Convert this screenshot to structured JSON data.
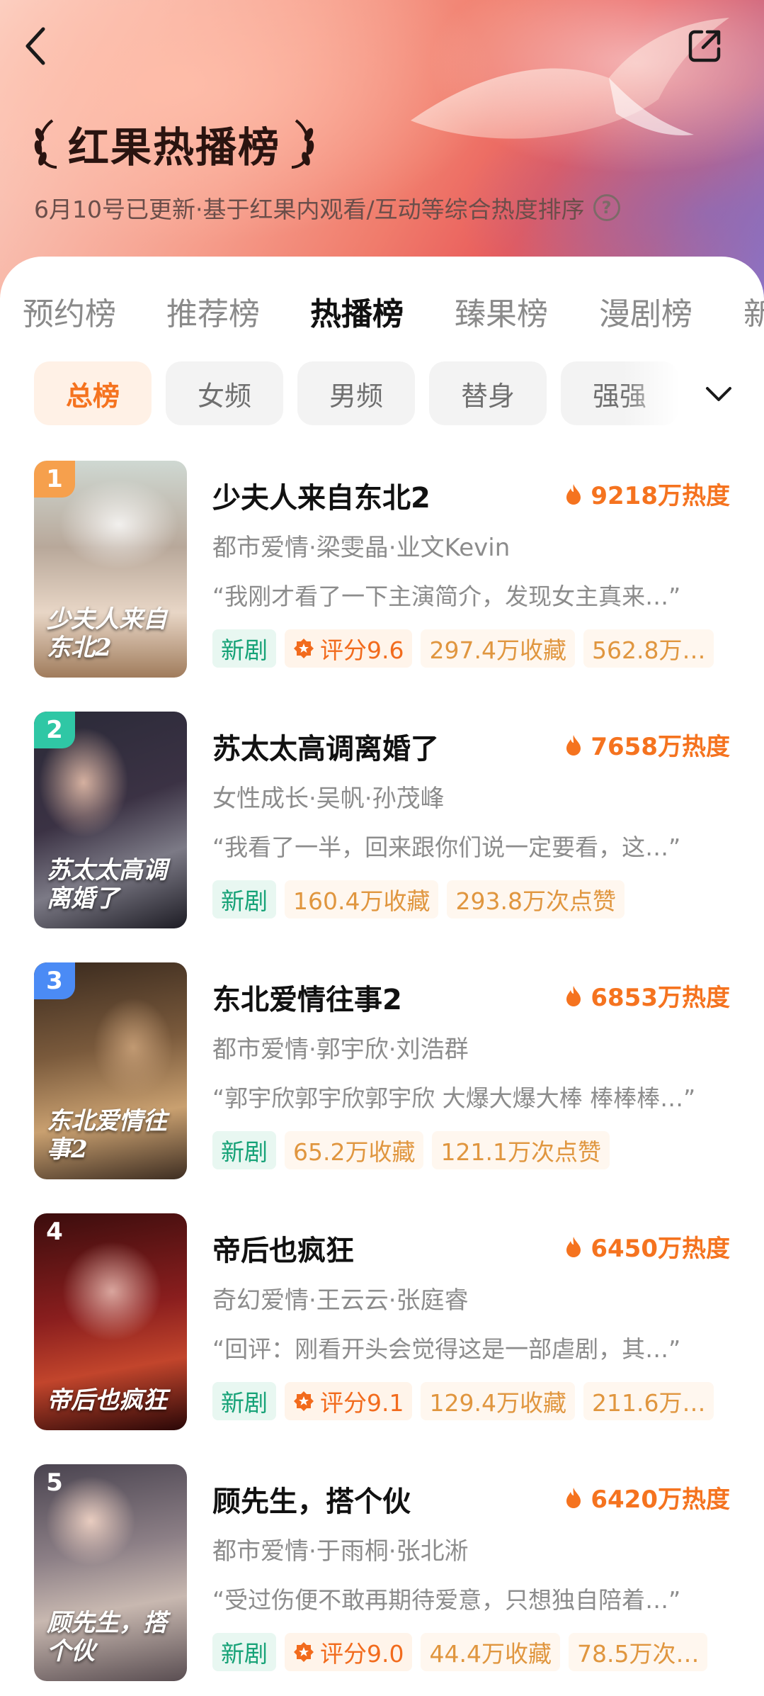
{
  "header": {
    "title": "红果热播榜",
    "subtitle": "6月10号已更新·基于红果内观看/互动等综合热度排序",
    "help_glyph": "?"
  },
  "icons": {
    "back": "chevron-left-icon",
    "share": "share-icon",
    "help": "question-circle-icon",
    "expand": "chevron-down-icon",
    "heat": "flame-icon",
    "score": "badge-icon"
  },
  "colors": {
    "accent": "#f5731f",
    "new_tag": "#16a277",
    "rank1": "#f6a04d",
    "rank2": "#2fc7a5",
    "rank3": "#4b8bf5"
  },
  "tabs": [
    {
      "label": "预约榜",
      "active": false
    },
    {
      "label": "推荐榜",
      "active": false
    },
    {
      "label": "热播榜",
      "active": true
    },
    {
      "label": "臻果榜",
      "active": false
    },
    {
      "label": "漫剧榜",
      "active": false
    },
    {
      "label": "新",
      "active": false
    }
  ],
  "chips": [
    {
      "label": "总榜",
      "active": true
    },
    {
      "label": "女频",
      "active": false
    },
    {
      "label": "男频",
      "active": false
    },
    {
      "label": "替身",
      "active": false
    },
    {
      "label": "强强",
      "active": false
    }
  ],
  "dramas": [
    {
      "rank": "1",
      "title": "少夫人来自东北2",
      "heat": "9218万热度",
      "meta": "都市爱情·梁雯晶·业文Kevin",
      "quote": "“我刚才看了一下主演简介，发现女主真来…”",
      "poster_text": "少夫人来自东北2",
      "tags": [
        {
          "type": "new",
          "label": "新剧"
        },
        {
          "type": "score",
          "label": "评分9.6"
        },
        {
          "type": "stat",
          "label": "297.4万收藏"
        },
        {
          "type": "stat",
          "label": "562.8万…"
        }
      ]
    },
    {
      "rank": "2",
      "title": "苏太太高调离婚了",
      "heat": "7658万热度",
      "meta": "女性成长·吴帆·孙茂峰",
      "quote": "“我看了一半，回来跟你们说一定要看，这…”",
      "poster_text": "苏太太高调离婚了",
      "tags": [
        {
          "type": "new",
          "label": "新剧"
        },
        {
          "type": "stat",
          "label": "160.4万收藏"
        },
        {
          "type": "stat",
          "label": "293.8万次点赞"
        }
      ]
    },
    {
      "rank": "3",
      "title": "东北爱情往事2",
      "heat": "6853万热度",
      "meta": "都市爱情·郭宇欣·刘浩群",
      "quote": "“郭宇欣郭宇欣郭宇欣 大爆大爆大棒 棒棒棒…”",
      "poster_text": "东北爱情往事2",
      "tags": [
        {
          "type": "new",
          "label": "新剧"
        },
        {
          "type": "stat",
          "label": "65.2万收藏"
        },
        {
          "type": "stat",
          "label": "121.1万次点赞"
        }
      ]
    },
    {
      "rank": "4",
      "title": "帝后也疯狂",
      "heat": "6450万热度",
      "meta": "奇幻爱情·王云云·张庭睿",
      "quote": "“回评：刚看开头会觉得这是一部虐剧，其…”",
      "poster_text": "帝后也疯狂",
      "tags": [
        {
          "type": "new",
          "label": "新剧"
        },
        {
          "type": "score",
          "label": "评分9.1"
        },
        {
          "type": "stat",
          "label": "129.4万收藏"
        },
        {
          "type": "stat",
          "label": "211.6万…"
        }
      ]
    },
    {
      "rank": "5",
      "title": "顾先生，搭个伙",
      "heat": "6420万热度",
      "meta": "都市爱情·于雨桐·张北淅",
      "quote": "“受过伤便不敢再期待爱意，只想独自陪着…”",
      "poster_text": "顾先生，搭个伙",
      "tags": [
        {
          "type": "new",
          "label": "新剧"
        },
        {
          "type": "score",
          "label": "评分9.0"
        },
        {
          "type": "stat",
          "label": "44.4万收藏"
        },
        {
          "type": "stat",
          "label": "78.5万次…"
        }
      ]
    }
  ]
}
